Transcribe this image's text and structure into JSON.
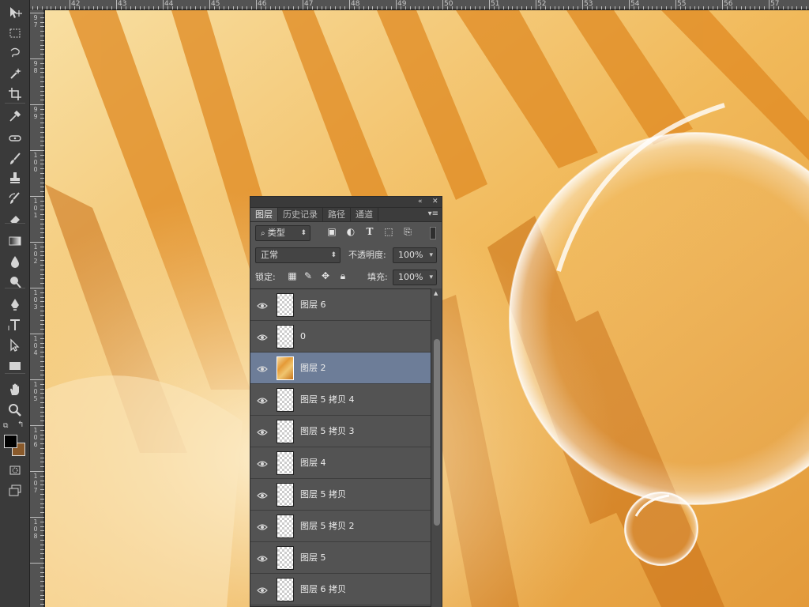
{
  "toolbar": {
    "tools": [
      {
        "name": "move-tool-icon",
        "glyph": "move"
      },
      {
        "name": "marquee-tool-icon",
        "glyph": "marquee"
      },
      {
        "name": "lasso-tool-icon",
        "glyph": "lasso"
      },
      {
        "name": "magic-wand-tool-icon",
        "glyph": "wand"
      },
      {
        "name": "crop-tool-icon",
        "glyph": "crop"
      },
      {
        "name": "eyedropper-tool-icon",
        "glyph": "eyedropper"
      },
      {
        "name": "healing-brush-tool-icon",
        "glyph": "heal"
      },
      {
        "name": "brush-tool-icon",
        "glyph": "brush"
      },
      {
        "name": "clone-stamp-tool-icon",
        "glyph": "stamp"
      },
      {
        "name": "history-brush-tool-icon",
        "glyph": "history"
      },
      {
        "name": "eraser-tool-icon",
        "glyph": "eraser"
      },
      {
        "name": "gradient-tool-icon",
        "glyph": "gradient"
      },
      {
        "name": "blur-tool-icon",
        "glyph": "blur"
      },
      {
        "name": "dodge-tool-icon",
        "glyph": "dodge"
      },
      {
        "name": "pen-tool-icon",
        "glyph": "pen"
      },
      {
        "name": "type-tool-icon",
        "glyph": "type"
      },
      {
        "name": "path-selection-tool-icon",
        "glyph": "pathsel"
      },
      {
        "name": "shape-tool-icon",
        "glyph": "shape"
      },
      {
        "name": "hand-tool-icon",
        "glyph": "hand"
      },
      {
        "name": "zoom-tool-icon",
        "glyph": "zoom"
      }
    ],
    "foreground_color": "#000000",
    "background_color": "#8a5a2b"
  },
  "rulers": {
    "top_labels": [
      "42",
      "43",
      "44",
      "45",
      "46",
      "47",
      "48",
      "49",
      "50",
      "51",
      "52",
      "53",
      "54",
      "55",
      "56",
      "57"
    ],
    "left_labels": [
      "9\n7",
      "9\n8",
      "9\n9",
      "1\n0\n0",
      "1\n0\n1",
      "1\n0\n2",
      "1\n0\n3",
      "1\n0\n4",
      "1\n0\n5",
      "1\n0\n6",
      "1\n0\n7",
      "1\n0\n8"
    ]
  },
  "layers_panel": {
    "tabs": [
      "图层",
      "历史记录",
      "路径",
      "通道"
    ],
    "active_tab": 0,
    "filter_kind": "类型",
    "blend_mode": "正常",
    "opacity_label": "不透明度:",
    "opacity_value": "100%",
    "lock_label": "锁定:",
    "fill_label": "填充:",
    "fill_value": "100%",
    "layers": [
      {
        "name": "图层 6",
        "selected": false,
        "thumb": "transparent"
      },
      {
        "name": "0",
        "selected": false,
        "thumb": "transparent"
      },
      {
        "name": "图层 2",
        "selected": true,
        "thumb": "image"
      },
      {
        "name": "图层 5 拷贝 4",
        "selected": false,
        "thumb": "transparent"
      },
      {
        "name": "图层 5 拷贝 3",
        "selected": false,
        "thumb": "transparent"
      },
      {
        "name": "图层 4",
        "selected": false,
        "thumb": "transparent"
      },
      {
        "name": "图层 5 拷贝",
        "selected": false,
        "thumb": "transparent"
      },
      {
        "name": "图层 5 拷贝 2",
        "selected": false,
        "thumb": "transparent"
      },
      {
        "name": "图层 5",
        "selected": false,
        "thumb": "transparent"
      },
      {
        "name": "图层 6 拷贝",
        "selected": false,
        "thumb": "transparent"
      }
    ]
  }
}
